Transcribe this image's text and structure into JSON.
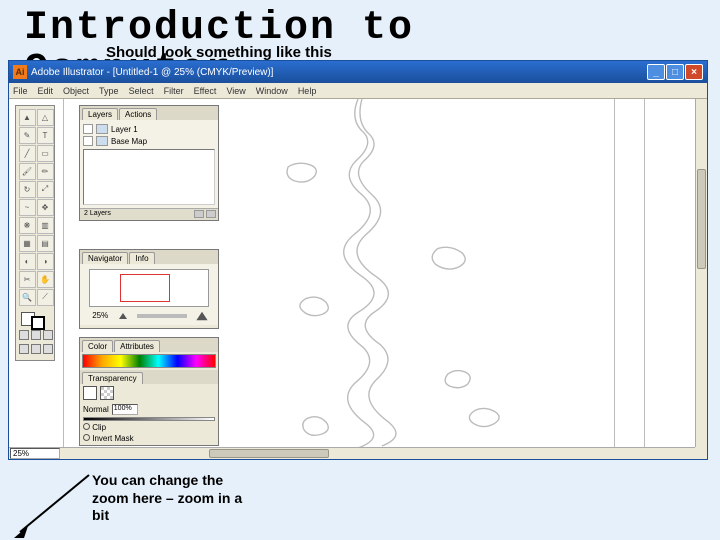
{
  "slide": {
    "title_line1": "Introduction to",
    "title_line2": "Computer",
    "intro_text": "Should look something like this",
    "callout": "You can change the zoom here – zoom in a bit"
  },
  "app": {
    "title": "Adobe Illustrator - [Untitled-1 @ 25% (CMYK/Preview)]",
    "menu": [
      "File",
      "Edit",
      "Object",
      "Type",
      "Select",
      "Filter",
      "Effect",
      "View",
      "Window",
      "Help"
    ],
    "win_min": "_",
    "win_max": "□",
    "win_close": "×"
  },
  "layers": {
    "tab1": "Layers",
    "tab2": "Actions",
    "item1": "Layer 1",
    "item2": "Base Map",
    "footer_count": "2 Layers"
  },
  "navigator": {
    "tab": "Navigator",
    "tab2": "Info",
    "zoom_pct": "25%"
  },
  "color": {
    "tab1": "Color",
    "tab2": "Attributes",
    "trans_tab": "Transparency",
    "opt_normal": "Normal",
    "opt_clip": "Clip",
    "opt_invert": "Invert Mask",
    "pct": "100%"
  },
  "statusbar": {
    "zoom": "25%"
  }
}
